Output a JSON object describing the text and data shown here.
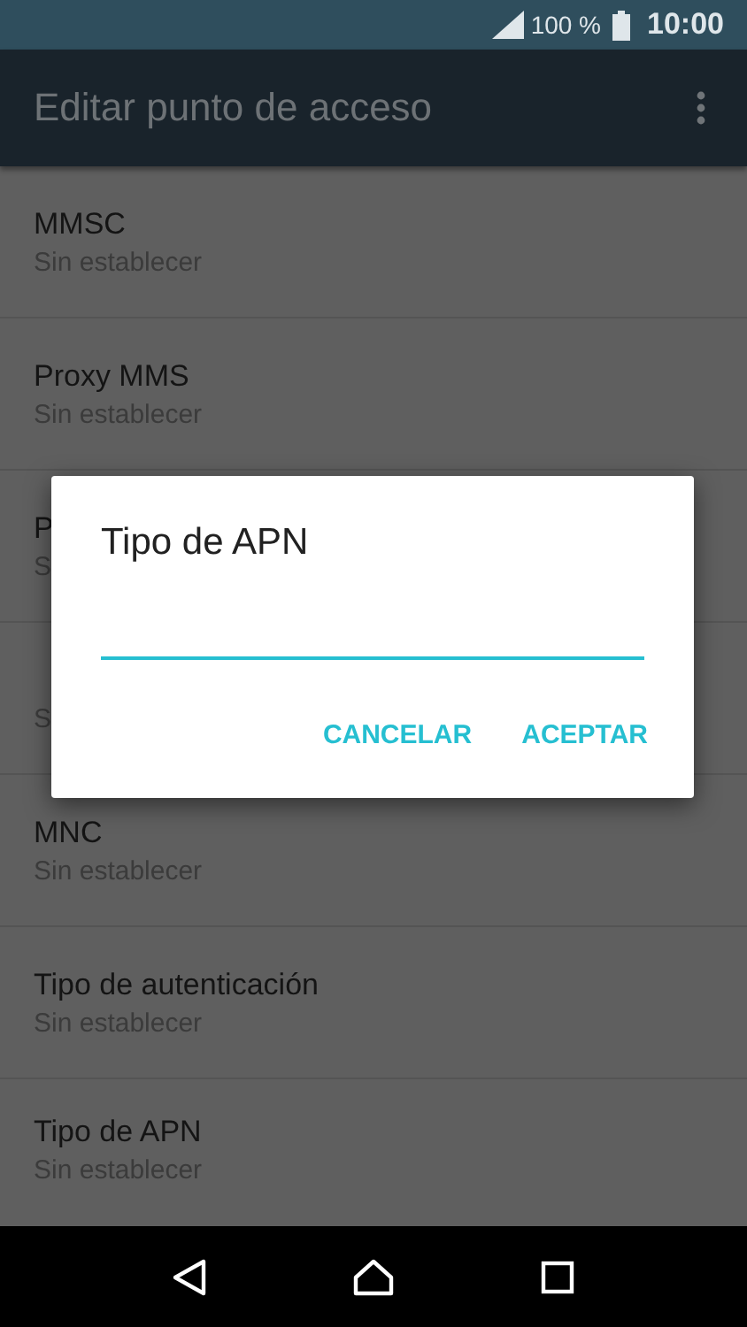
{
  "status_bar": {
    "battery": "100 %",
    "time": "10:00"
  },
  "app_bar": {
    "title": "Editar punto de acceso"
  },
  "settings": [
    {
      "title": "MMSC",
      "value": "Sin establecer"
    },
    {
      "title": "Proxy MMS",
      "value": "Sin establecer"
    },
    {
      "title": "P",
      "value": "S"
    },
    {
      "value": "S"
    },
    {
      "title": "MNC",
      "value": "Sin establecer"
    },
    {
      "title": "Tipo de autenticación",
      "value": "Sin establecer"
    },
    {
      "title": "Tipo de APN",
      "value": "Sin establecer"
    }
  ],
  "dialog": {
    "title": "Tipo de APN",
    "buttons": [
      "CANCELAR",
      "ACEPTAR"
    ]
  }
}
